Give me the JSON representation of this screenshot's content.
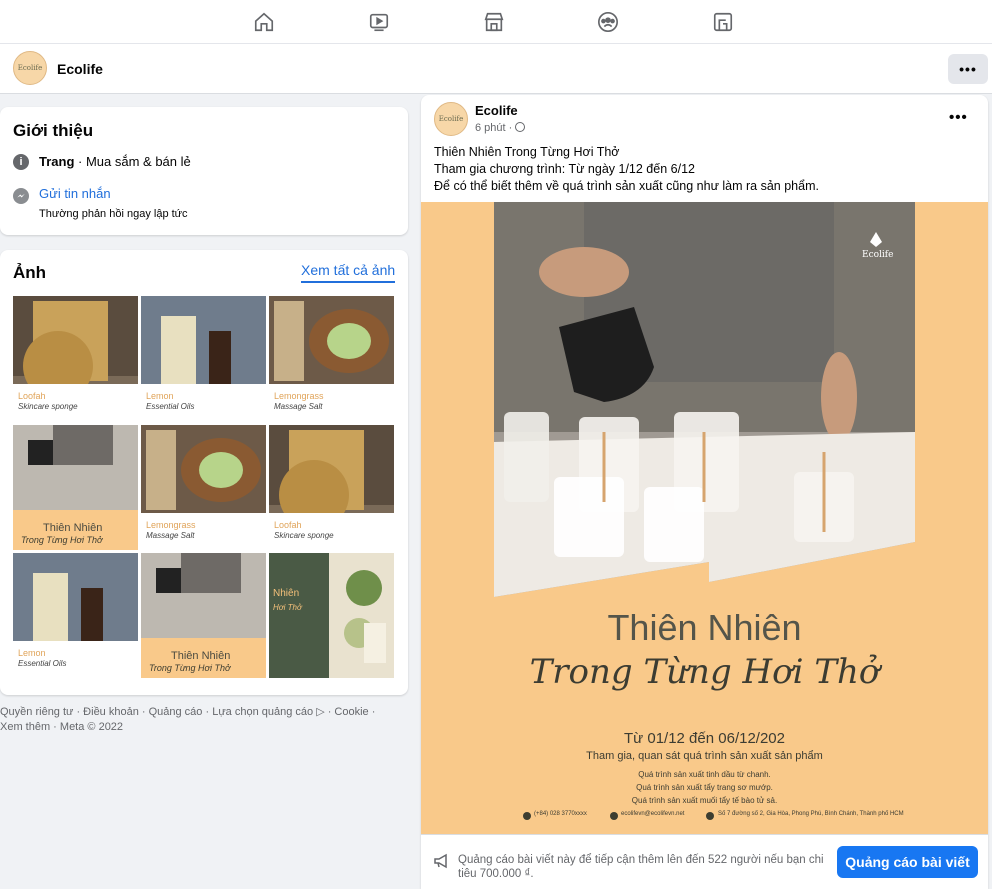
{
  "nav": {
    "icons": [
      "home-icon",
      "watch-icon",
      "marketplace-icon",
      "groups-icon",
      "gaming-icon"
    ]
  },
  "page": {
    "name": "Ecolife",
    "avatar_text": "Ecolife",
    "more": "•••"
  },
  "intro": {
    "title": "Giới thiệu",
    "category_label": "Trang",
    "category": " · Mua sắm & bán lẻ",
    "message": "Gửi tin nhắn",
    "response": "Thường phản hồi ngay lập tức"
  },
  "photos": {
    "title": "Ảnh",
    "see_all": "Xem tất cả ảnh",
    "items": [
      {
        "label": "Loofah",
        "sub": "Skincare sponge"
      },
      {
        "label": "Lemon",
        "sub": "Essential Oils"
      },
      {
        "label": "Lemongrass",
        "sub": "Massage Salt"
      },
      {
        "label": "Thiên Nhiên",
        "sub": "Trong Từng Hơi Thở"
      },
      {
        "label": "Lemongrass",
        "sub": "Massage Salt"
      },
      {
        "label": "Loofah",
        "sub": "Skincare sponge"
      },
      {
        "label": "Lemon",
        "sub": "Essential Oils"
      },
      {
        "label": "Thiên Nhiên",
        "sub": "Trong Từng Hơi Thở"
      },
      {
        "label": "Nhiên",
        "sub": "Hơi Thở"
      }
    ]
  },
  "footer": {
    "text": "Quyền riêng tư · Điều khoản · Quảng cáo · Lựa chọn quảng cáo ▷ · Cookie · Xem thêm · Meta © 2022"
  },
  "post": {
    "author": "Ecolife",
    "time": "6 phút · ",
    "more": "•••",
    "line1": "Thiên Nhiên Trong Từng Hơi Thở",
    "line2": "Tham gia chương trình: Từ ngày 1/12 đến 6/12",
    "line3": "Để có thể biết thêm về quá trình sản xuất cũng như làm ra sản phẩm.",
    "poster": {
      "logo": "Ecolife",
      "title1": "Thiên Nhiên",
      "title2": "Trong Từng Hơi Thở",
      "date": "Từ 01/12 đến 06/12/202",
      "sub": "Tham gia, quan sát quá trình sản xuất sản phẩm",
      "b1": "Quá trình sản xuất tinh dầu từ chanh.",
      "b2": "Quá trình sản xuất tẩy trang sơ mướp.",
      "b3": "Quá trình sản xuất muối tẩy tế bào tử sả.",
      "phone": "(+84) 028 3770xxxx",
      "email": "ecolifevn@ecolifevn.net",
      "address": "Số 7 đường số 2, Gia Hòa, Phong Phú, Bình Chánh, Thành phố HCM"
    },
    "ad_text": "Quảng cáo bài viết này để tiếp cận thêm lên đến 522 người nếu bạn chi tiêu 700.000 ₫.",
    "ad_button": "Quảng cáo bài viết"
  }
}
